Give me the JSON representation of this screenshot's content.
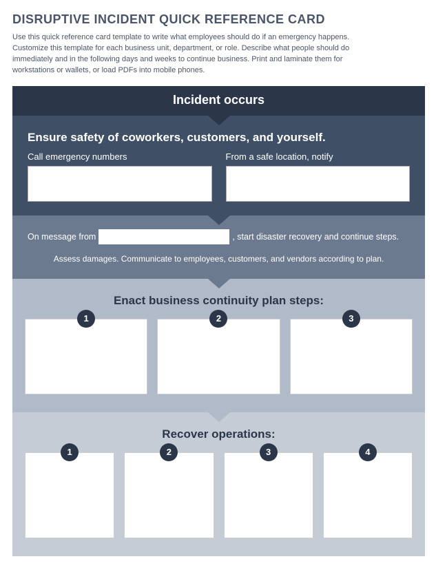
{
  "title": "DISRUPTIVE INCIDENT QUICK REFERENCE CARD",
  "intro": "Use this quick reference card template to write what employees should do if an emergency happens. Customize this template for each business unit, department, or role.  Describe what people should do immediately and in the following days and weeks to continue business.  Print and laminate them for workstations or wallets, or load PDFs into mobile phones.",
  "banner": "Incident occurs",
  "safety": {
    "title": "Ensure safety of coworkers, customers, and yourself.",
    "col1_label": "Call emergency numbers",
    "col2_label": "From a safe location, notify"
  },
  "message": {
    "prefix": "On message from",
    "suffix": ", start disaster recovery and continue steps.",
    "line2": "Assess damages.  Communicate to employees, customers, and vendors according to plan."
  },
  "continuity": {
    "title": "Enact business continuity plan steps:",
    "steps": [
      "1",
      "2",
      "3"
    ]
  },
  "recover": {
    "title": "Recover operations:",
    "steps": [
      "1",
      "2",
      "3",
      "4"
    ]
  }
}
